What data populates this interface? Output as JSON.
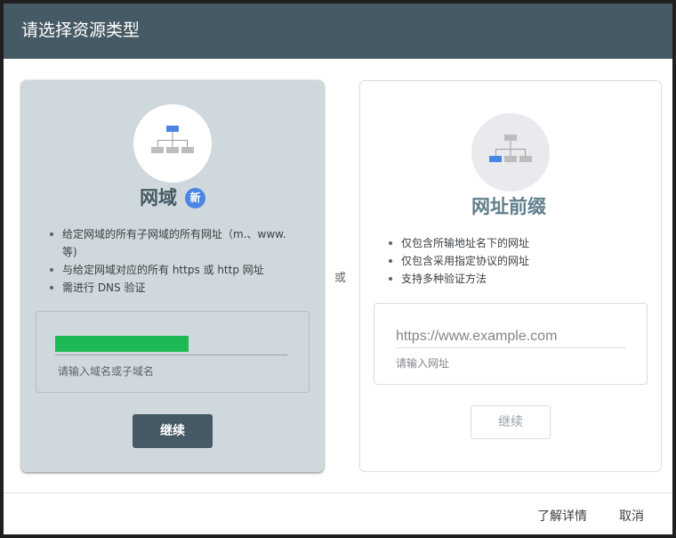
{
  "dialog": {
    "title": "请选择资源类型"
  },
  "domain_card": {
    "title": "网域",
    "badge": "新",
    "bullets": [
      "给定网域的所有子网域的所有网址（m.、www. 等)",
      "与给定网域对应的所有 https 或 http 网址",
      "需进行 DNS 验证"
    ],
    "input_hint": "请输入域名或子域名",
    "continue_label": "继续",
    "icon": "sitemap-icon",
    "colors": {
      "card_bg": "#cfd8dc",
      "input_fill": "#1db954",
      "button_bg": "#455a64",
      "badge_bg": "#4a85e6"
    }
  },
  "separator": {
    "label": "或"
  },
  "prefix_card": {
    "title": "网址前缀",
    "bullets": [
      "仅包含所输地址名下的网址",
      "仅包含采用指定协议的网址",
      "支持多种验证方法"
    ],
    "input_placeholder": "https://www.example.com",
    "input_hint": "请输入网址",
    "continue_label": "继续",
    "icon": "sitemap-icon"
  },
  "footer": {
    "learn_more": "了解详情",
    "cancel": "取消"
  }
}
